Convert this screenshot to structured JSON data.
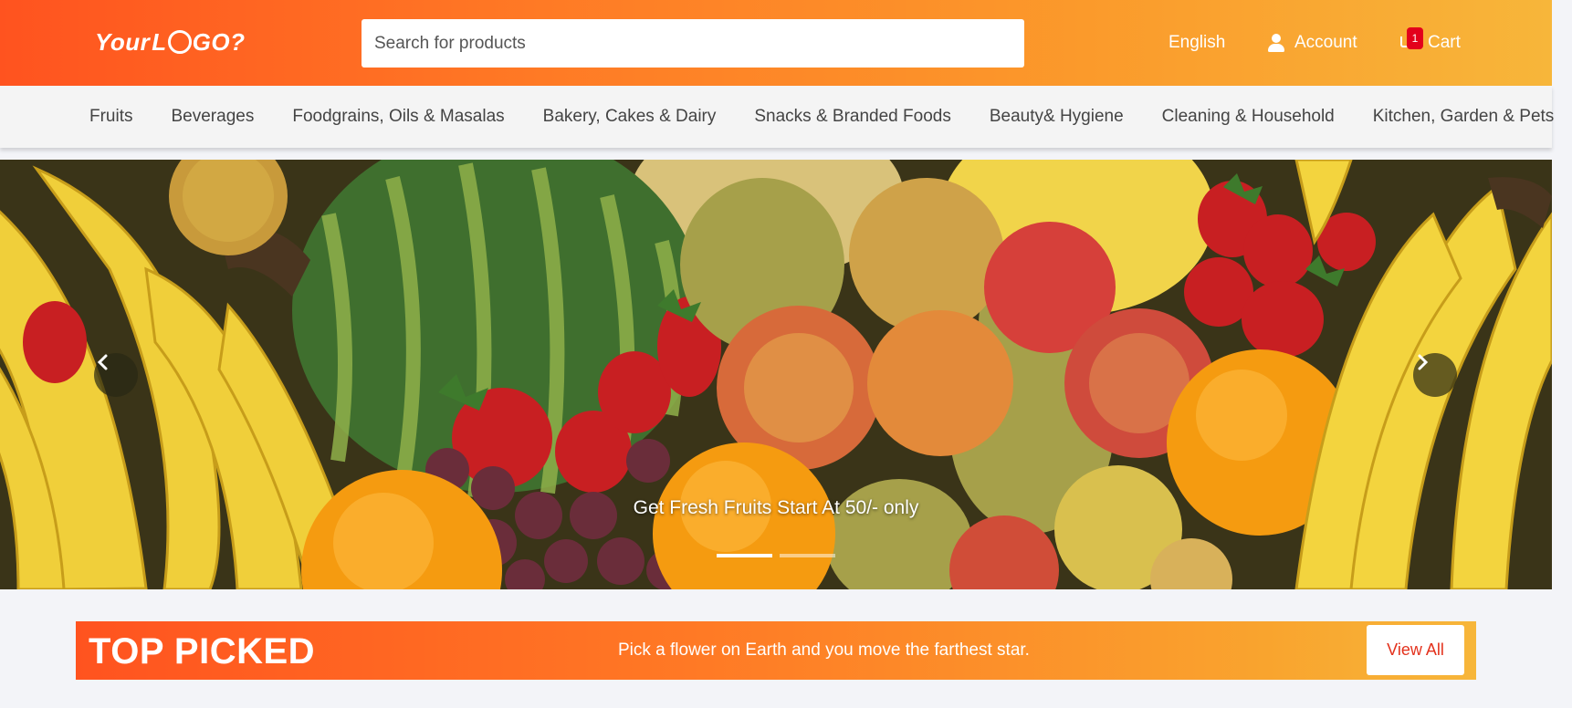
{
  "header": {
    "logo_text_1": "Your",
    "logo_text_2": "L",
    "logo_text_3": "GO?",
    "search_placeholder": "Search for products",
    "language": "English",
    "account_label": "Account",
    "cart_label": "Cart",
    "cart_count": "1"
  },
  "categories": [
    "Fruits",
    "Beverages",
    "Foodgrains, Oils & Masalas",
    "Bakery, Cakes & Dairy",
    "Snacks & Branded Foods",
    "Beauty& Hygiene",
    "Cleaning & Household",
    "Kitchen, Garden & Pets"
  ],
  "hero": {
    "caption": "Get Fresh Fruits Start At 50/- only",
    "active_slide": 1,
    "slide_count": 2
  },
  "top_picked": {
    "title": "TOP PICKED",
    "tagline": "Pick a flower on Earth and you move the farthest star.",
    "view_all_label": "View All"
  },
  "colors": {
    "brand_orange": "#ff531f",
    "brand_yellow": "#f7b63a",
    "badge_red": "#e3001b",
    "view_all_text": "#e3311c"
  }
}
